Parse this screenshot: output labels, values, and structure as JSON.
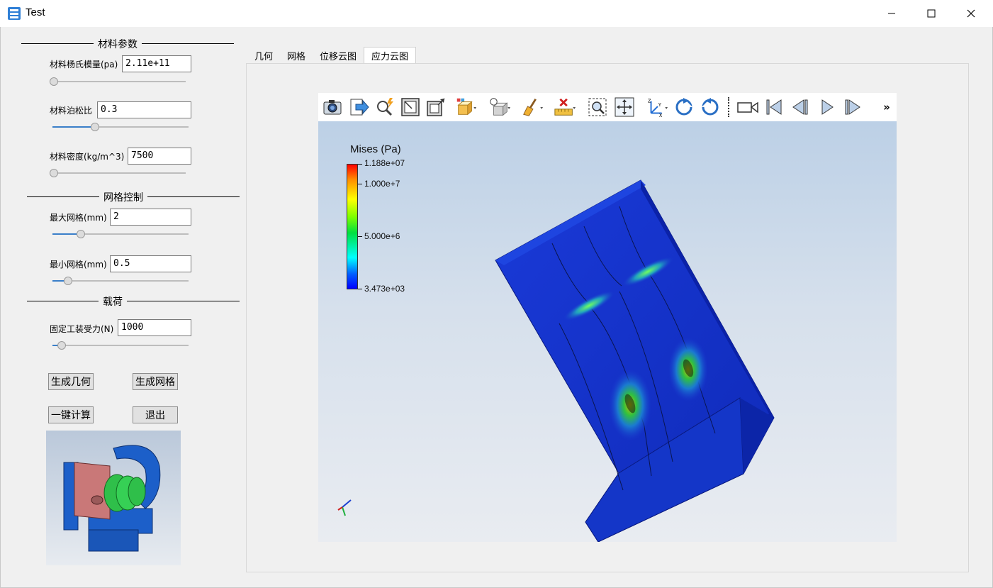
{
  "window": {
    "title": "Test",
    "icons": {
      "app": "app-icon",
      "minimize": "minimize-icon",
      "maximize": "maximize-icon",
      "close": "close-icon"
    }
  },
  "material": {
    "section_title": "材料参数",
    "youngs_label": "材料杨氏模量(pa)",
    "youngs_value": "2.11e+11",
    "youngs_slider": 0.0,
    "poisson_label": "材料泊松比",
    "poisson_value": "0.3",
    "poisson_slider": 0.3,
    "density_label": "材料密度(kg/m^3)",
    "density_value": "7500",
    "density_slider": 0.0
  },
  "mesh": {
    "section_title": "网格控制",
    "max_label": "最大网格(mm)",
    "max_value": "2",
    "max_slider": 0.19,
    "min_label": "最小网格(mm)",
    "min_value": "0.5",
    "min_slider": 0.09
  },
  "load": {
    "section_title": "载荷",
    "force_label": "固定工装受力(N)",
    "force_value": "1000",
    "force_slider": 0.04
  },
  "buttons": {
    "gen_geometry": "生成几何",
    "gen_mesh": "生成网格",
    "compute": "一键计算",
    "exit": "退出"
  },
  "tabs": [
    {
      "label": "几何",
      "active": false
    },
    {
      "label": "网格",
      "active": false
    },
    {
      "label": "位移云图",
      "active": false
    },
    {
      "label": "应力云图",
      "active": true
    }
  ],
  "toolbar": {
    "icons": [
      "camera-icon",
      "export-icon",
      "query-icon",
      "fit-icon",
      "frame-icon",
      "display-mode-icon",
      "light-icon",
      "clean-icon",
      "measure-icon",
      "zoom-box-icon",
      "pan-icon",
      "axes-icon",
      "rotate-cw-icon",
      "rotate-ccw-icon",
      "video-icon",
      "first-frame-icon",
      "prev-frame-icon",
      "play-icon",
      "last-frame-icon",
      "more-icon"
    ],
    "more": "»"
  },
  "legend": {
    "title": "Mises (Pa)",
    "labels": [
      "1.188e+07",
      "1.000e+7",
      "5.000e+6",
      "3.473e+03"
    ],
    "colors": {
      "max": "#ff0000",
      "mid": "#00e040",
      "min": "#0000ff"
    }
  }
}
